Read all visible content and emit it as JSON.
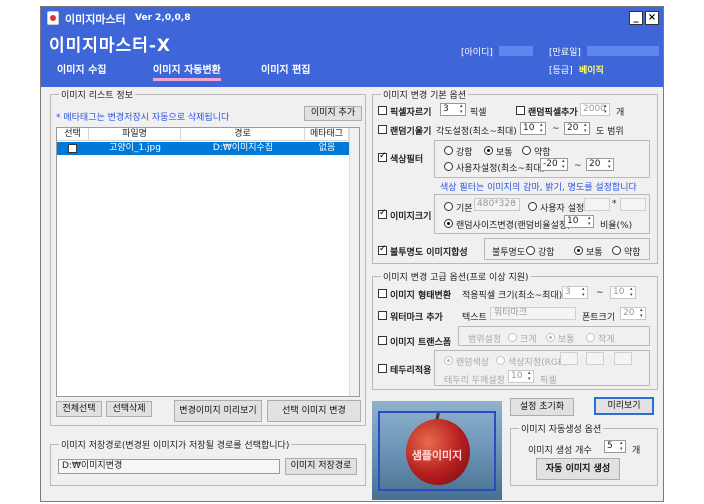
{
  "titlebar": {
    "title": "이미지마스터",
    "version": "Ver 2,0,0,8",
    "minimize": "_",
    "close": "×"
  },
  "header": {
    "app_title": "이미지마스터-X",
    "id_label": "[아이디]",
    "expire_label": "[만료일]",
    "grade_label": "[등급]",
    "grade_value": "베이직"
  },
  "tabs": [
    {
      "label": "이미지 수집"
    },
    {
      "label": "이미지 자동변환"
    },
    {
      "label": "이미지 편집"
    }
  ],
  "list_panel": {
    "title": "이미지 리스트 정보",
    "note": "* 메타태그는 변경저장시 자동으로 삭제됩니다",
    "add_button": "이미지 추가",
    "columns": [
      "선택",
      "파일명",
      "경로",
      "메타태그"
    ],
    "rows": [
      {
        "checked": false,
        "filename": "고양이_1.jpg",
        "path": "D:₩이미지수집",
        "meta": "없음"
      }
    ],
    "select_all": "전체선택",
    "delete_selected": "선택삭제",
    "preview_changed": "변경이미지 미리보기",
    "convert_selected": "선택 이미지 변경"
  },
  "save_panel": {
    "title": "이미지 저장경로(변경된 이미지가 저장될 경로를 선택합니다)",
    "path_value": "D:₩이미지변경",
    "save_button": "이미지 저장경로"
  },
  "basic_options": {
    "title": "이미지 변경 기본 옵션",
    "pixel_cut": {
      "label": "픽셀자르기",
      "value": "3",
      "unit": "픽셀",
      "checked": false
    },
    "random_pixel": {
      "label": "랜덤픽셀추가",
      "value": "2000",
      "unit": "개",
      "checked": false
    },
    "random_tilt": {
      "label": "랜덤기울기",
      "desc": "각도설정(최소~최대)",
      "min": "10",
      "sep": "~",
      "max": "20",
      "unit": "도 범위",
      "checked": false
    },
    "color_filter": {
      "label": "색상필터",
      "checked": true,
      "opt_strong": "강함",
      "opt_normal": "보통",
      "opt_weak": "약함",
      "opt_user": "사용자설정(최소~최대)",
      "user_min": "-20",
      "sep": "~",
      "user_max": "20",
      "note": "색상 필터는 이미지의 감마, 밝기, 명도를 설정합니다"
    },
    "image_size": {
      "label": "이미지크기",
      "checked": true,
      "opt_default": "기본",
      "default_value": "480*320",
      "opt_user": "사용자 설정",
      "star": "*",
      "opt_random": "랜덤사이즈변경(랜덤비율설정)",
      "random_value": "10",
      "random_unit": "비율(%)"
    },
    "opacity": {
      "label": "불투명도 이미지합성",
      "checked": true,
      "desc": "불투명도",
      "opt_strong": "강함",
      "opt_normal": "보통",
      "opt_weak": "약함"
    }
  },
  "advanced_options": {
    "title": "이미지 변경 고급 옵션(프로 이상 지원)",
    "shape": {
      "label": "이미지 형태변환",
      "desc": "적용픽셀 크기(최소~최대)",
      "min": "3",
      "sep": "~",
      "max": "10"
    },
    "watermark": {
      "label": "워터마크 추가",
      "text_label": "텍스트",
      "text_value": "워터마크",
      "font_label": "폰트크기",
      "font_value": "20"
    },
    "transform": {
      "label": "이미지 트랜스폼",
      "range_label": "범위설정",
      "opt_big": "크게",
      "opt_normal": "보통",
      "opt_small": "작게"
    },
    "border": {
      "label": "테두리적용",
      "opt_random": "랜덤색상",
      "opt_rgb": "색상지정(RGB)",
      "thickness_label": "테두리 두께설정",
      "thickness_value": "10",
      "thickness_unit": "픽셀"
    }
  },
  "actions": {
    "reset": "설정 초기화",
    "preview": "미리보기"
  },
  "sample": {
    "label": "샘플이미지"
  },
  "auto_gen": {
    "title": "이미지 자동생성 옵션",
    "count_label": "이미지 생성 개수",
    "count_value": "5",
    "count_unit": "개",
    "generate_button": "자동 이미지 생성"
  }
}
